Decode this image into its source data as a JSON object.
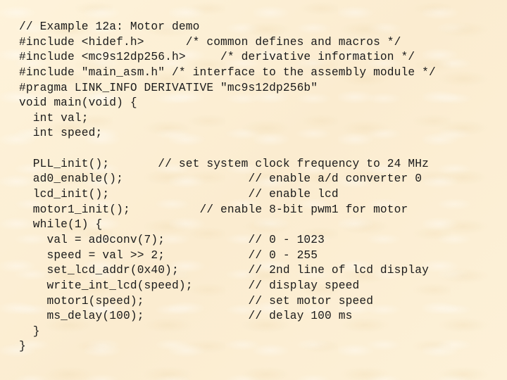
{
  "document": {
    "title": "Example 12a: Motor demo",
    "background_color": "#fdf0d4",
    "text_color": "#1a1a1a",
    "code_lines": [
      "// Example 12a: Motor demo",
      "#include <hidef.h>      /* common defines and macros */",
      "#include <mc9s12dp256.h>     /* derivative information */",
      "#include \"main_asm.h\" /* interface to the assembly module */",
      "#pragma LINK_INFO DERIVATIVE \"mc9s12dp256b\"",
      "void main(void) {",
      "  int val;",
      "  int speed;",
      "",
      "  PLL_init();       // set system clock frequency to 24 MHz",
      "  ad0_enable();                  // enable a/d converter 0",
      "  lcd_init();                    // enable lcd",
      "  motor1_init();          // enable 8-bit pwm1 for motor",
      "  while(1) {",
      "    val = ad0conv(7);            // 0 - 1023",
      "    speed = val >> 2;            // 0 - 255",
      "    set_lcd_addr(0x40);          // 2nd line of lcd display",
      "    write_int_lcd(speed);        // display speed",
      "    motor1(speed);               // set motor speed",
      "    ms_delay(100);               // delay 100 ms",
      "  }",
      "}"
    ]
  }
}
